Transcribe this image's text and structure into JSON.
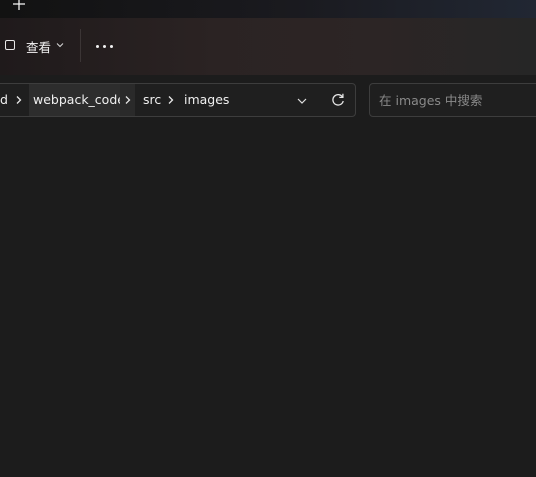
{
  "titlebar": {
    "new_tab_icon": "plus-icon"
  },
  "toolbar": {
    "view_label": "查看",
    "view_icon": "view-square-icon",
    "view_chevron_icon": "chevron-down-icon",
    "more_icon": "more-horizontal-icon"
  },
  "address_bar": {
    "breadcrumbs": [
      {
        "label": "d"
      },
      {
        "label": "webpack_code"
      },
      {
        "label": "src"
      },
      {
        "label": "images"
      }
    ],
    "separator_icon": "chevron-right-icon",
    "dropdown_icon": "chevron-down-icon",
    "refresh_icon": "refresh-icon"
  },
  "search": {
    "placeholder": "在 images 中搜索",
    "value": ""
  },
  "colors": {
    "background": "#1c1c1c",
    "toolbar": "#2b2323",
    "border": "#3d3d3d",
    "text": "#f0f0f0",
    "placeholder": "#8a8a8a"
  }
}
